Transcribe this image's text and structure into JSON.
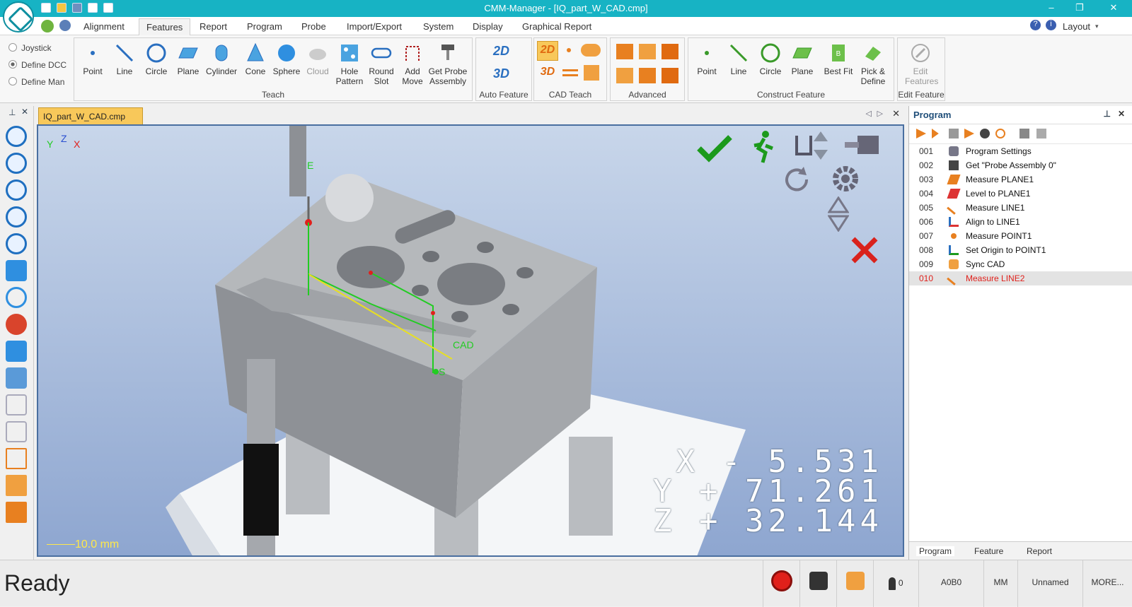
{
  "window": {
    "title": "CMM-Manager - [IQ_part_W_CAD.cmp]",
    "controls": [
      "–",
      "❐",
      "✕"
    ]
  },
  "menu": {
    "tabs": [
      "Alignment",
      "Features",
      "Report",
      "Program",
      "Probe",
      "Import/Export",
      "System",
      "Display",
      "Graphical Report"
    ],
    "active": "Features",
    "layout_label": "Layout",
    "layout_arrow": "▾",
    "help_icons": [
      "?",
      "i"
    ]
  },
  "ribbon": {
    "radios": [
      "Joystick",
      "Define DCC",
      "Define Man"
    ],
    "teach": {
      "label": "Teach",
      "buttons": [
        "Point",
        "Line",
        "Circle",
        "Plane",
        "Cylinder",
        "Cone",
        "Sphere",
        "Cloud",
        "Hole Pattern",
        "Round Slot",
        "Add Move",
        "Get Probe Assembly"
      ]
    },
    "auto_feature": {
      "label": "Auto Feature",
      "buttons": [
        "2D",
        "3D"
      ]
    },
    "cad_teach": {
      "label": "CAD Teach",
      "buttons": [
        "2D",
        "3D"
      ]
    },
    "advanced": {
      "label": "Advanced"
    },
    "construct": {
      "label": "Construct Feature",
      "buttons": [
        "Point",
        "Line",
        "Circle",
        "Plane",
        "Best Fit",
        "Pick & Define"
      ]
    },
    "edit_feature": {
      "label": "Edit Feature",
      "buttons": [
        "Edit Features"
      ]
    }
  },
  "document": {
    "tab": "IQ_part_W_CAD.cmp"
  },
  "viewport": {
    "axis_labels": {
      "y": "Y",
      "z": "Z",
      "x": "X"
    },
    "scale_label": "10.0 mm",
    "labels": {
      "e": "E",
      "s": "S",
      "cad": "CAD"
    },
    "coords": [
      {
        "axis": "X",
        "sign": "-",
        "value": "5.531"
      },
      {
        "axis": "Y",
        "sign": "+",
        "value": "71.261"
      },
      {
        "axis": "Z",
        "sign": "+",
        "value": "32.144"
      }
    ],
    "colors": {
      "ok": "#1c9a1c",
      "cancel": "#d9221c",
      "trace_green": "#22cc22",
      "trace_yellow": "#e8e020"
    }
  },
  "program_panel": {
    "title": "Program",
    "rows": [
      {
        "num": "001",
        "label": "Program Settings",
        "icon": "wrench-icon"
      },
      {
        "num": "002",
        "label": "Get \"Probe Assembly 0\"",
        "icon": "probe-icon"
      },
      {
        "num": "003",
        "label": "Measure PLANE1",
        "icon": "plane-icon"
      },
      {
        "num": "004",
        "label": "Level to PLANE1",
        "icon": "level-icon"
      },
      {
        "num": "005",
        "label": "Measure LINE1",
        "icon": "line-icon"
      },
      {
        "num": "006",
        "label": "Align to LINE1",
        "icon": "align-icon"
      },
      {
        "num": "007",
        "label": "Measure POINT1",
        "icon": "point-icon"
      },
      {
        "num": "008",
        "label": "Set Origin to POINT1",
        "icon": "origin-icon"
      },
      {
        "num": "009",
        "label": "Sync CAD",
        "icon": "sync-icon"
      },
      {
        "num": "010",
        "label": "Measure LINE2",
        "icon": "line-icon"
      }
    ],
    "selected_index": 9,
    "bottom_tabs": [
      "Program",
      "Feature",
      "Report"
    ]
  },
  "status": {
    "text": "Ready",
    "probe_count": "0",
    "a_b": "A0B0",
    "units": "MM",
    "name": "Unnamed",
    "more": "MORE..."
  }
}
